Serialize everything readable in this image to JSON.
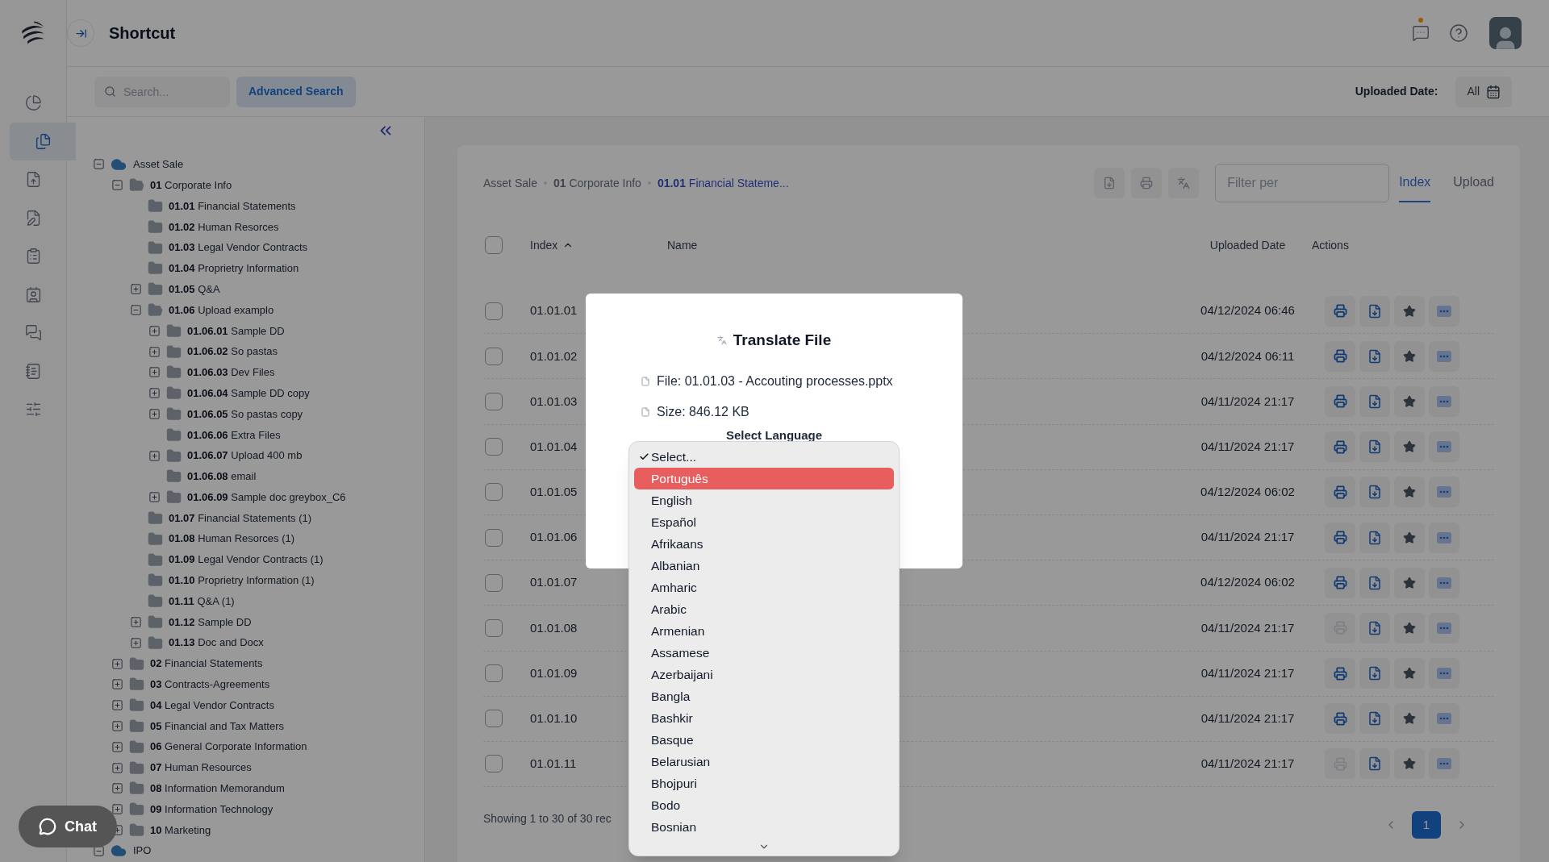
{
  "header": {
    "title": "Shortcut",
    "notification_dot": true
  },
  "rail": [
    {
      "kind": "chart",
      "selected": false
    },
    {
      "kind": "files",
      "selected": true
    },
    {
      "kind": "upload",
      "selected": false
    },
    {
      "kind": "edit",
      "selected": false
    },
    {
      "kind": "clipboard",
      "selected": false
    },
    {
      "kind": "contact",
      "selected": false
    },
    {
      "kind": "messages",
      "selected": false
    },
    {
      "kind": "notebook",
      "selected": false
    },
    {
      "kind": "sliders",
      "selected": false
    }
  ],
  "search": {
    "placeholder": "Search...",
    "advanced_button": "Advanced Search"
  },
  "uploaded_date_filter": {
    "label": "Uploaded Date:",
    "value": "All"
  },
  "tree": [
    {
      "kind": "cloud",
      "name": "Asset Sale",
      "expanded": true,
      "children": [
        {
          "kind": "folder",
          "code": "01",
          "name": "Corporate Info",
          "expanded": true,
          "children": [
            {
              "kind": "folder",
              "code": "01.01",
              "name": "Financial Statements"
            },
            {
              "kind": "folder",
              "code": "01.02",
              "name": "Human Resorces"
            },
            {
              "kind": "folder",
              "code": "01.03",
              "name": "Legal Vendor Contracts"
            },
            {
              "kind": "folder",
              "code": "01.04",
              "name": "Proprietry Information"
            },
            {
              "kind": "folder",
              "code": "01.05",
              "name": "Q&A",
              "expanded": false
            },
            {
              "kind": "folder",
              "code": "01.06",
              "name": "Upload examplo",
              "expanded": true,
              "children": [
                {
                  "kind": "folder",
                  "code": "01.06.01",
                  "name": "Sample DD",
                  "expanded": false
                },
                {
                  "kind": "folder",
                  "code": "01.06.02",
                  "name": "So pastas",
                  "expanded": false
                },
                {
                  "kind": "folder",
                  "code": "01.06.03",
                  "name": "Dev Files",
                  "expanded": false
                },
                {
                  "kind": "folder",
                  "code": "01.06.04",
                  "name": "Sample DD copy",
                  "expanded": false
                },
                {
                  "kind": "folder",
                  "code": "01.06.05",
                  "name": "So pastas copy",
                  "expanded": false
                },
                {
                  "kind": "folder",
                  "code": "01.06.06",
                  "name": "Extra Files"
                },
                {
                  "kind": "folder",
                  "code": "01.06.07",
                  "name": "Upload 400 mb",
                  "expanded": false
                },
                {
                  "kind": "folder",
                  "code": "01.06.08",
                  "name": "email"
                },
                {
                  "kind": "folder",
                  "code": "01.06.09",
                  "name": "Sample doc greybox_C6",
                  "expanded": false
                }
              ]
            },
            {
              "kind": "folder",
              "code": "01.07",
              "name": "Financial Statements (1)"
            },
            {
              "kind": "folder",
              "code": "01.08",
              "name": "Human Resorces (1)"
            },
            {
              "kind": "folder",
              "code": "01.09",
              "name": "Legal Vendor Contracts (1)"
            },
            {
              "kind": "folder",
              "code": "01.10",
              "name": "Proprietry Information (1)"
            },
            {
              "kind": "folder",
              "code": "01.11",
              "name": "Q&A (1)"
            },
            {
              "kind": "folder",
              "code": "01.12",
              "name": "Sample DD",
              "expanded": false
            },
            {
              "kind": "folder",
              "code": "01.13",
              "name": "Doc and Docx",
              "expanded": false
            }
          ]
        },
        {
          "kind": "folder",
          "code": "02",
          "name": "Financial Statements",
          "expanded": false
        },
        {
          "kind": "folder",
          "code": "03",
          "name": "Contracts-Agreements",
          "expanded": false
        },
        {
          "kind": "folder",
          "code": "04",
          "name": "Legal Vendor Contracts",
          "expanded": false
        },
        {
          "kind": "folder",
          "code": "05",
          "name": "Financial and Tax Matters",
          "expanded": false
        },
        {
          "kind": "folder",
          "code": "06",
          "name": "General Corporate Information",
          "expanded": false
        },
        {
          "kind": "folder",
          "code": "07",
          "name": "Human Resources",
          "expanded": false
        },
        {
          "kind": "folder",
          "code": "08",
          "name": "Information Memorandum",
          "expanded": false
        },
        {
          "kind": "folder",
          "code": "09",
          "name": "Information Technology",
          "expanded": false
        },
        {
          "kind": "folder",
          "code": "10",
          "name": "Marketing",
          "expanded": false
        }
      ]
    },
    {
      "kind": "cloud",
      "name": "IPO",
      "expanded": true
    }
  ],
  "breadcrumb": [
    {
      "name": "Asset Sale",
      "current": false
    },
    {
      "code": "01",
      "name": "Corporate Info",
      "current": false
    },
    {
      "code": "01.01",
      "name": "Financial Stateme...",
      "current": true
    }
  ],
  "filter": {
    "placeholder": "Filter per"
  },
  "tabs": [
    {
      "label": "Index",
      "selected": true
    },
    {
      "label": "Upload",
      "selected": false
    }
  ],
  "table": {
    "columns": [
      "Index",
      "Name",
      "Uploaded Date",
      "Actions"
    ],
    "select_all_checked": false,
    "rows": [
      {
        "checked": false,
        "index": "01.01.01",
        "date": "04/12/2024 06:46",
        "translate_enabled": true
      },
      {
        "checked": false,
        "index": "01.01.02",
        "date": "04/12/2024 06:11",
        "translate_enabled": true
      },
      {
        "checked": false,
        "index": "01.01.03",
        "date": "04/11/2024 21:17",
        "translate_enabled": true
      },
      {
        "checked": false,
        "index": "01.01.04",
        "date": "04/11/2024 21:17",
        "translate_enabled": true
      },
      {
        "checked": false,
        "index": "01.01.05",
        "date": "04/12/2024 06:02",
        "translate_enabled": true
      },
      {
        "checked": false,
        "index": "01.01.06",
        "date": "04/11/2024 21:17",
        "translate_enabled": true
      },
      {
        "checked": false,
        "index": "01.01.07",
        "date": "04/12/2024 06:02",
        "translate_enabled": true
      },
      {
        "checked": false,
        "index": "01.01.08",
        "date": "04/11/2024 21:17",
        "translate_enabled": false
      },
      {
        "checked": false,
        "index": "01.01.09",
        "date": "04/11/2024 21:17",
        "translate_enabled": true
      },
      {
        "checked": false,
        "index": "01.01.10",
        "date": "04/11/2024 21:17",
        "translate_enabled": true
      },
      {
        "checked": false,
        "index": "01.01.11",
        "date": "04/11/2024 21:17",
        "translate_enabled": false
      }
    ]
  },
  "footer": {
    "showing": "Showing 1 to 30 of 30 rec",
    "pages": [
      {
        "label": "1",
        "selected": true
      }
    ]
  },
  "chat_button": "Chat",
  "modal": {
    "title": "Translate File",
    "file": "File: 01.01.03 - Accouting processes.pptx",
    "size": "Size: 846.12 KB",
    "language_label": "Select Language"
  },
  "language_options": [
    {
      "label": "Select...",
      "checked": true,
      "highlighted": false
    },
    {
      "label": "Português",
      "checked": false,
      "highlighted": true
    },
    {
      "label": "English",
      "checked": false,
      "highlighted": false
    },
    {
      "label": "Español",
      "checked": false,
      "highlighted": false
    },
    {
      "label": "Afrikaans",
      "checked": false,
      "highlighted": false
    },
    {
      "label": "Albanian",
      "checked": false,
      "highlighted": false
    },
    {
      "label": "Amharic",
      "checked": false,
      "highlighted": false
    },
    {
      "label": "Arabic",
      "checked": false,
      "highlighted": false
    },
    {
      "label": "Armenian",
      "checked": false,
      "highlighted": false
    },
    {
      "label": "Assamese",
      "checked": false,
      "highlighted": false
    },
    {
      "label": "Azerbaijani",
      "checked": false,
      "highlighted": false
    },
    {
      "label": "Bangla",
      "checked": false,
      "highlighted": false
    },
    {
      "label": "Bashkir",
      "checked": false,
      "highlighted": false
    },
    {
      "label": "Basque",
      "checked": false,
      "highlighted": false
    },
    {
      "label": "Belarusian",
      "checked": false,
      "highlighted": false
    },
    {
      "label": "Bhojpuri",
      "checked": false,
      "highlighted": false
    },
    {
      "label": "Bodo",
      "checked": false,
      "highlighted": false
    },
    {
      "label": "Bosnian",
      "checked": false,
      "highlighted": false
    }
  ]
}
